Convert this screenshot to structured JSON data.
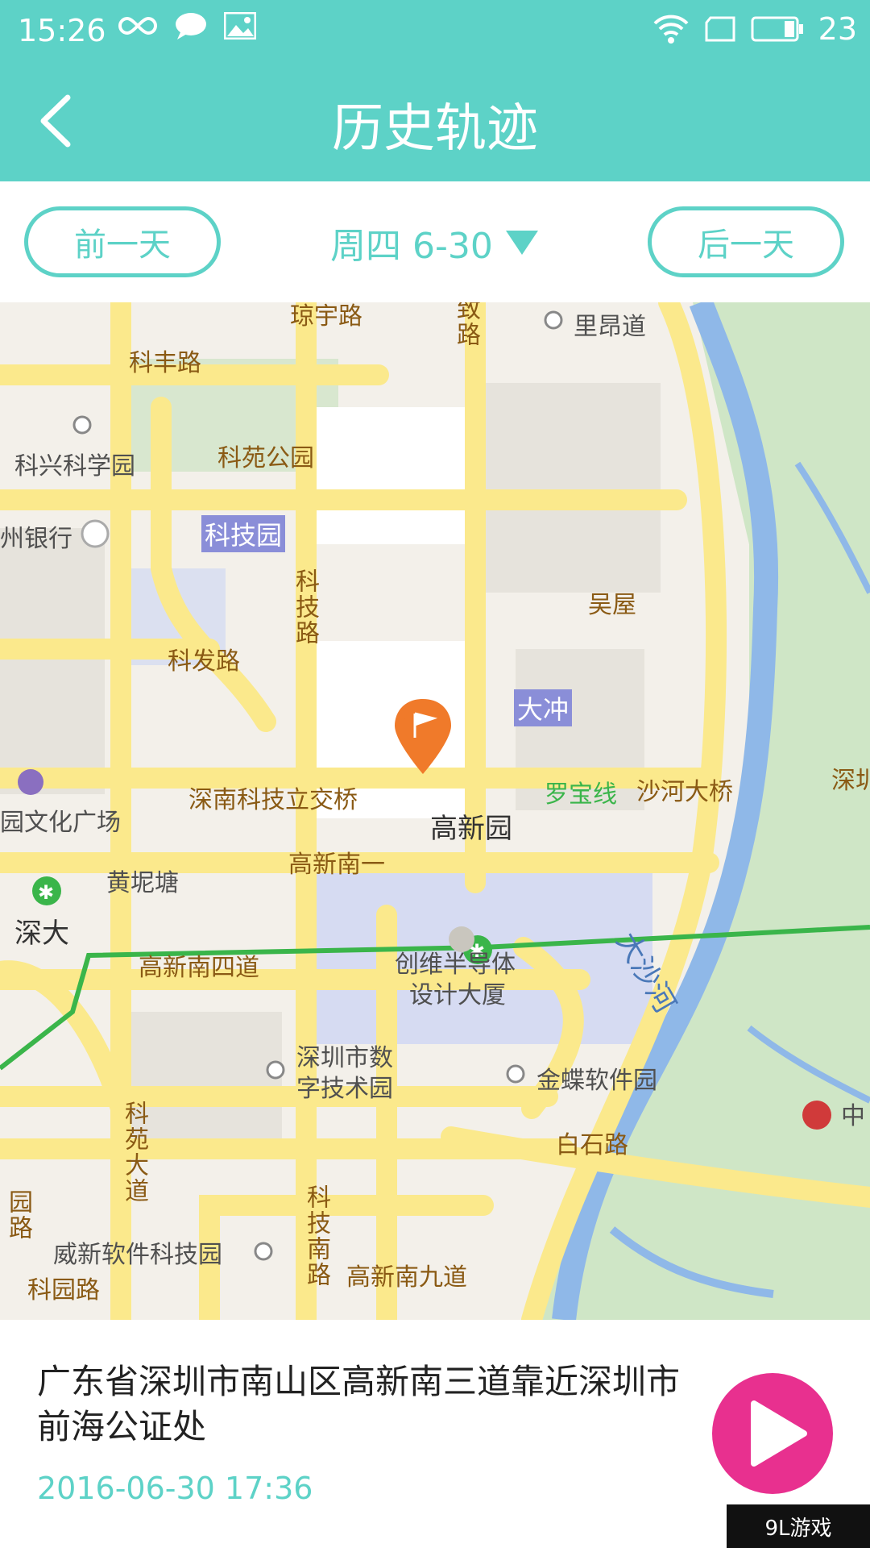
{
  "status_bar": {
    "time": "15:26",
    "battery": "23"
  },
  "header": {
    "title": "历史轨迹"
  },
  "day_switch": {
    "prev_label": "前一天",
    "date_label": "周四 6-30",
    "next_label": "后一天"
  },
  "map": {
    "labels": {
      "road_jingu": "琼宇路",
      "road_top_mid": "致路",
      "liang_dao": "里昂道",
      "kefeng": "科丰路",
      "kexing": "科兴科学园",
      "keyuan_park": "科苑公园",
      "bank": "州银行",
      "kejiyuan": "科技园",
      "keji_road": "科技路",
      "wuwu": "吴屋",
      "kefa": "科发路",
      "dachong": "大冲",
      "shennan_bridge": "深南科技立交桥",
      "luobao": "罗宝线",
      "shahe_bridge": "沙河大桥",
      "shen_right": "深圳",
      "wenhua": "园文化广场",
      "gaoxinyuan": "高新园",
      "gaoxin_nan1": "高新南一",
      "huangnitang": "黄坭塘",
      "shenda": "深大",
      "dashahe": "大沙河",
      "gaoxin_nan4": "高新南四道",
      "chuangwei": "创维半导体",
      "sheji": "设计大厦",
      "shuzi1": "深圳市数",
      "shuzi2": "字技术园",
      "kingdee": "金蝶软件园",
      "zhong": "中",
      "keyuan_road": "科苑大道",
      "baishi": "白石路",
      "keji_south": "科技南路",
      "weixin": "威新软件科技园",
      "gaoxin_nan9": "高新南九道",
      "keyuan_lu": "科园路",
      "xiang": "园路"
    }
  },
  "location": {
    "address": "广东省深圳市南山区高新南三道靠近深圳市前海公证处",
    "timestamp": "2016-06-30 17:36"
  },
  "watermark": "9L游戏",
  "colors": {
    "accent": "#5dd2c7",
    "play": "#e8308f",
    "road": "#fbe98c",
    "metro": "#3ab54a",
    "river": "#8fb8e8",
    "park": "#cfe6c6"
  },
  "icons": {
    "back": "chevron-left-icon",
    "play": "play-icon",
    "pin": "flag-pin-icon"
  }
}
